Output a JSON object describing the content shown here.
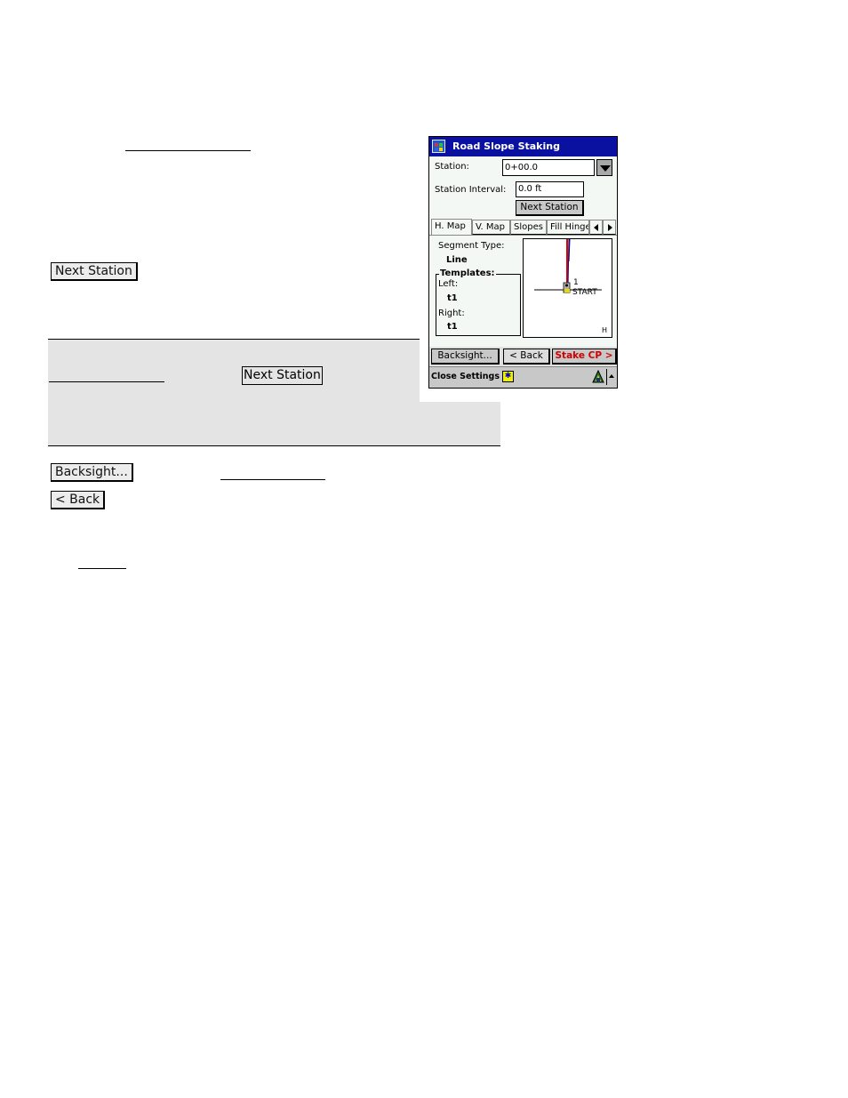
{
  "document": {
    "inline_buttons": {
      "next_station": "Next Station",
      "next_station_note": "Next Station",
      "backsight": "Backsight...",
      "back": "< Back"
    }
  },
  "device": {
    "title": "Road Slope Staking",
    "station_label": "Station:",
    "station_value": "0+00.0",
    "station_interval_label": "Station Interval:",
    "station_interval_value": "0.0 ft",
    "next_station_button": "Next Station",
    "tabs": [
      {
        "label": "H. Map",
        "active": true
      },
      {
        "label": "V. Map",
        "active": false
      },
      {
        "label": "Slopes",
        "active": false
      },
      {
        "label": "Fill Hinge",
        "active": false
      }
    ],
    "segment_type_label": "Segment Type:",
    "segment_type_value": "Line",
    "templates_label": "Templates:",
    "left_label": "Left:",
    "left_value": "t1",
    "right_label": "Right:",
    "right_value": "t1",
    "map": {
      "point_label": "1",
      "start_label": "START",
      "view_indicator": "H",
      "colors": {
        "alignment_red": "#e00000",
        "alignment_blue": "#000080"
      }
    },
    "buttons": {
      "backsight": "Backsight...",
      "back": "< Back",
      "stake_cp": "Stake CP >"
    },
    "status": {
      "close_settings": "Close Settings"
    },
    "colors": {
      "titlebar": "#0a10a0",
      "stake_text": "#d00000"
    }
  }
}
